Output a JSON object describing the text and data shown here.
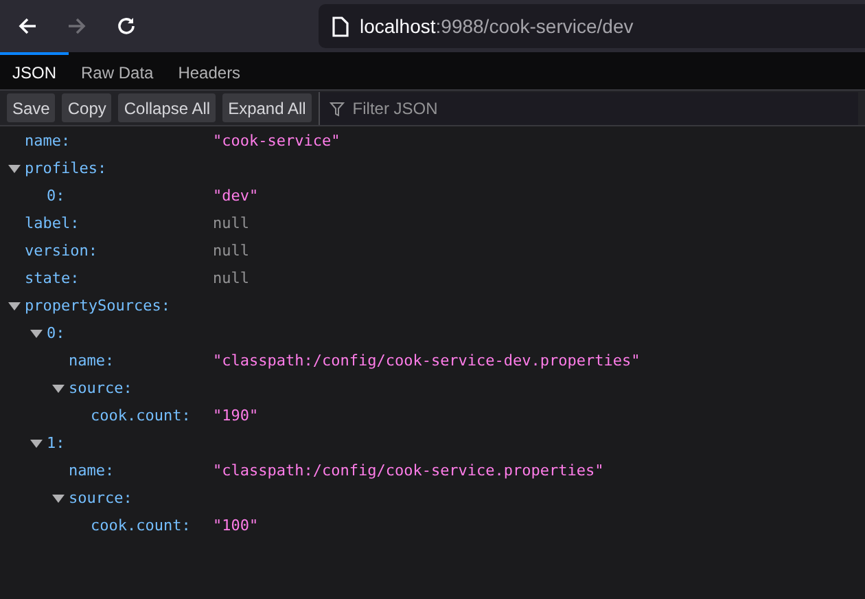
{
  "browser": {
    "address_host": "localhost",
    "address_path": ":9988/cook-service/dev",
    "back_disabled": false,
    "forward_disabled": true
  },
  "tabs": [
    {
      "label": "JSON",
      "selected": true
    },
    {
      "label": "Raw Data",
      "selected": false
    },
    {
      "label": "Headers",
      "selected": false
    }
  ],
  "toolbar": {
    "buttons": [
      "Save",
      "Copy",
      "Collapse All",
      "Expand All"
    ],
    "filter_placeholder": "Filter JSON"
  },
  "tree": [
    {
      "key": "name:",
      "value": "\"cook-service\"",
      "kind": "string"
    },
    {
      "key": "profiles:",
      "expanded": true,
      "children": [
        {
          "key": "0:",
          "value": "\"dev\"",
          "kind": "string"
        }
      ]
    },
    {
      "key": "label:",
      "value": "null",
      "kind": "null"
    },
    {
      "key": "version:",
      "value": "null",
      "kind": "null"
    },
    {
      "key": "state:",
      "value": "null",
      "kind": "null"
    },
    {
      "key": "propertySources:",
      "expanded": true,
      "children": [
        {
          "key": "0:",
          "expanded": true,
          "children": [
            {
              "key": "name:",
              "value": "\"classpath:/config/cook-service-dev.properties\"",
              "kind": "string"
            },
            {
              "key": "source:",
              "expanded": true,
              "children": [
                {
                  "key": "cook.count:",
                  "value": "\"190\"",
                  "kind": "string"
                }
              ]
            }
          ]
        },
        {
          "key": "1:",
          "expanded": true,
          "children": [
            {
              "key": "name:",
              "value": "\"classpath:/config/cook-service.properties\"",
              "kind": "string"
            },
            {
              "key": "source:",
              "expanded": true,
              "children": [
                {
                  "key": "cook.count:",
                  "value": "\"100\"",
                  "kind": "string"
                }
              ]
            }
          ]
        }
      ]
    }
  ]
}
